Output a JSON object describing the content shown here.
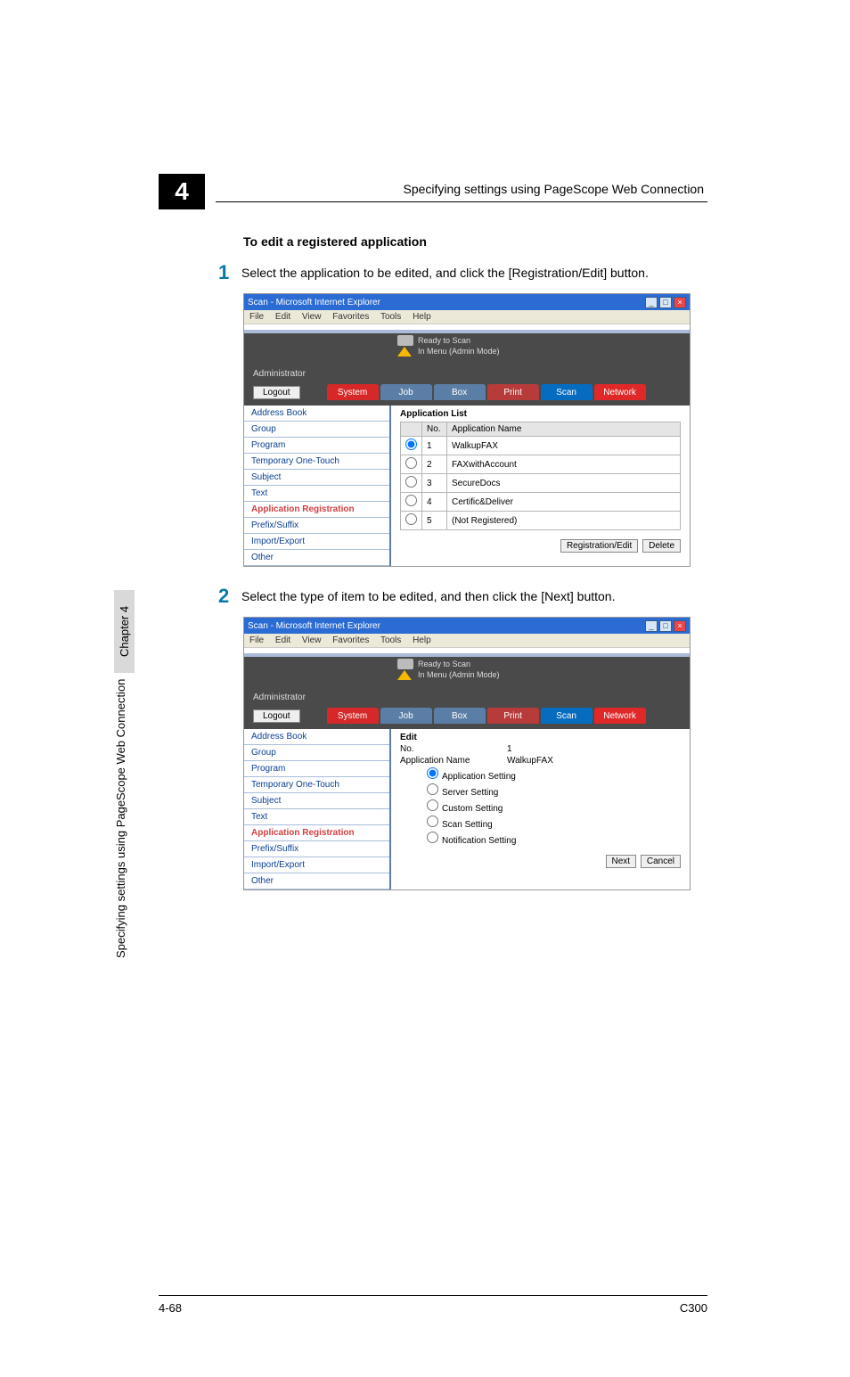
{
  "header": {
    "chapter_box": "4",
    "header_text": "Specifying settings using PageScope Web Connection"
  },
  "side": {
    "rotated_label": "Specifying settings using PageScope Web Connection",
    "chapter_label": "Chapter 4"
  },
  "section_title": "To edit a registered application",
  "steps": {
    "s1_num": "1",
    "s1_text": "Select the application to be edited, and click the [Registration/Edit] button.",
    "s2_num": "2",
    "s2_text": "Select the type of item to be edited, and then click the [Next] button."
  },
  "ie": {
    "title": "Scan - Microsoft Internet Explorer",
    "menu": {
      "file": "File",
      "edit": "Edit",
      "view": "View",
      "fav": "Favorites",
      "tools": "Tools",
      "help": "Help"
    },
    "ready": "Ready to Scan",
    "menu_mode": "In Menu (Admin Mode)",
    "admin": "Administrator",
    "logout": "Logout",
    "tabs": {
      "system": "System",
      "job": "Job",
      "box": "Box",
      "print": "Print",
      "scan": "Scan",
      "network": "Network"
    }
  },
  "sidenav": {
    "addr": "Address Book",
    "group": "Group",
    "program": "Program",
    "temp": "Temporary One-Touch",
    "subject": "Subject",
    "text": "Text",
    "appreg": "Application Registration",
    "prefix": "Prefix/Suffix",
    "impexp": "Import/Export",
    "other": "Other"
  },
  "applist": {
    "title": "Application List",
    "col_no": "No.",
    "col_name": "Application Name",
    "rows": [
      {
        "no": "1",
        "name": "WalkupFAX"
      },
      {
        "no": "2",
        "name": "FAXwithAccount"
      },
      {
        "no": "3",
        "name": "SecureDocs"
      },
      {
        "no": "4",
        "name": "Certific&Deliver"
      },
      {
        "no": "5",
        "name": "(Not Registered)"
      }
    ],
    "regedit": "Registration/Edit",
    "delete": "Delete"
  },
  "editpanel": {
    "title": "Edit",
    "no_lbl": "No.",
    "no_val": "1",
    "an_lbl": "Application Name",
    "an_val": "WalkupFAX",
    "opts": {
      "app": "Application Setting",
      "srv": "Server Setting",
      "cust": "Custom Setting",
      "scan": "Scan Setting",
      "notif": "Notification Setting"
    },
    "next": "Next",
    "cancel": "Cancel"
  },
  "footer": {
    "left": "4-68",
    "right": "C300"
  }
}
